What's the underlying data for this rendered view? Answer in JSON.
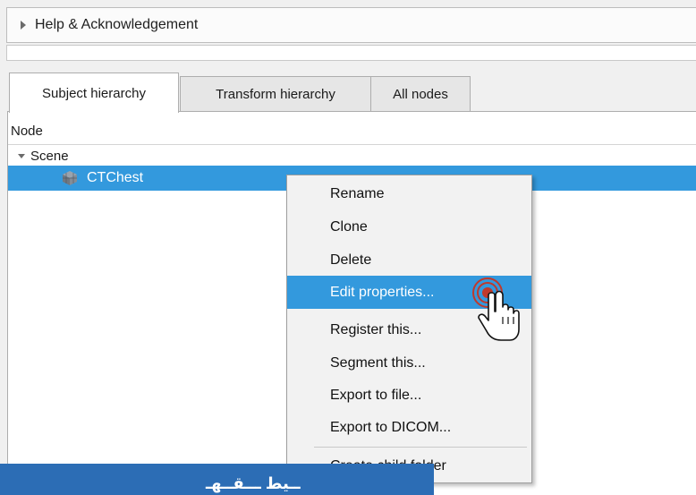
{
  "collapsible": {
    "label": "Help & Acknowledgement",
    "icon": "expand-arrow-icon"
  },
  "tabs": [
    {
      "label": "Subject hierarchy",
      "active": true
    },
    {
      "label": "Transform hierarchy",
      "active": false
    },
    {
      "label": "All nodes",
      "active": false
    }
  ],
  "tree": {
    "column_header": "Node",
    "scene_label": "Scene",
    "node_label": "CTChest",
    "node_icon": "volume-cube-icon",
    "selected_color": "#3399dd"
  },
  "context_menu": {
    "items": [
      {
        "label": "Rename",
        "highlighted": false
      },
      {
        "label": "Clone",
        "highlighted": false
      },
      {
        "label": "Delete",
        "highlighted": false
      },
      {
        "label": "Edit properties...",
        "highlighted": true
      },
      {
        "label": "Register this...",
        "highlighted": false
      },
      {
        "label": "Segment this...",
        "highlighted": false
      },
      {
        "label": "Export to file...",
        "highlighted": false
      },
      {
        "label": "Export to DICOM...",
        "highlighted": false
      },
      {
        "label": "Create child folder",
        "highlighted": false
      }
    ]
  },
  "cursor": {
    "icon": "hand-pointer-icon",
    "click_indicator": "click-target-icon",
    "accent": "#c0392b"
  },
  "caption": {
    "text": "ــيط ـــقــهـ",
    "color": "#2c6db5"
  }
}
